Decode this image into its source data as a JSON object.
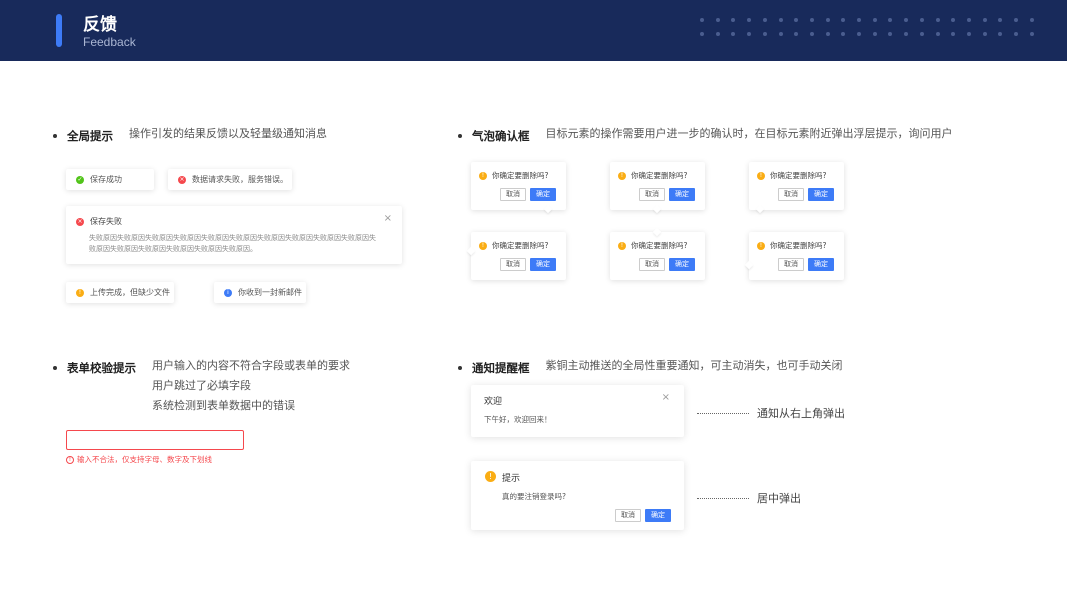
{
  "header": {
    "title": "反馈",
    "subtitle": "Feedback"
  },
  "global_tip": {
    "name": "全局提示",
    "desc": "操作引发的结果反馈以及轻量级通知消息",
    "success": "保存成功",
    "request_error": "数据请求失败，服务错误。",
    "fail_title": "保存失败",
    "fail_body": "失败原因失败原因失败原因失败原因失败原因失败原因失败原因失败原因失败原因失败原因失败原因失败原因失败原因失败原因失败原因失败原因。",
    "warning": "上传完成，但缺少文件",
    "info": "你收到一封新邮件"
  },
  "bubble_confirm": {
    "name": "气泡确认框",
    "desc": "目标元素的操作需要用户进一步的确认时，在目标元素附近弹出浮层提示，询问用户",
    "question": "你确定要删除吗?",
    "cancel": "取消",
    "ok": "确定"
  },
  "form_validation": {
    "name": "表单校验提示",
    "desc_lines": [
      "用户输入的内容不符合字段或表单的要求",
      "用户跳过了必填字段",
      "系统检测到表单数据中的错误"
    ],
    "input_value": "",
    "error": "输入不合法，仅支持字母、数字及下划线"
  },
  "notification": {
    "name": "通知提醒框",
    "desc": "紫铜主动推送的全局性重要通知，可主动消失，也可手动关闭",
    "welcome_title": "欢迎",
    "welcome_body": "下午好，欢迎回来！",
    "welcome_note": "通知从右上角弹出",
    "tip_title": "提示",
    "tip_body": "真的要注销登录吗?",
    "cancel": "取消",
    "ok": "确定",
    "tip_note": "居中弹出"
  },
  "colors": {
    "header_bg": "#182a5b",
    "accent": "#3d7bf7",
    "error": "#f5484d",
    "success": "#52c41a",
    "warning": "#faad14"
  }
}
